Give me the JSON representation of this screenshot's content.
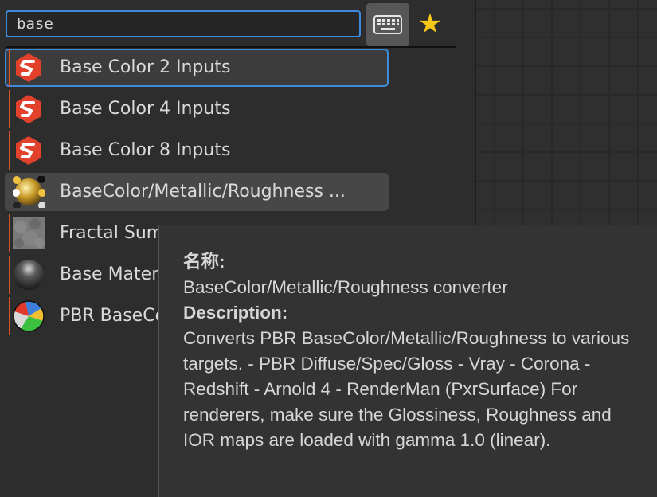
{
  "search": {
    "value": "base"
  },
  "toolbar": {
    "keyboard_icon": "keyboard-icon",
    "favorite_icon": "star-icon",
    "star_color": "#f5c518"
  },
  "colors": {
    "accent": "#3d8bdb",
    "category_bar": "#d4562a",
    "substance_red": "#e2412c"
  },
  "results": [
    {
      "label": "Base Color 2 Inputs",
      "icon": "substance-logo-icon"
    },
    {
      "label": "Base Color 4  Inputs",
      "icon": "substance-logo-icon"
    },
    {
      "label": "Base Color 8 Inputs",
      "icon": "substance-logo-icon"
    },
    {
      "label": "BaseColor/Metallic/Roughness ...",
      "icon": "material-balls-icon"
    },
    {
      "label": "Fractal Sum Base",
      "icon": "fractal-noise-thumbnail-icon"
    },
    {
      "label": "Base Material",
      "icon": "material-sphere-icon"
    },
    {
      "label": "PBR BaseColor",
      "icon": "pbr-sphere-icon"
    }
  ],
  "tooltip": {
    "name_label": "名称:",
    "name_value": "BaseColor/Metallic/Roughness converter",
    "description_label": "Description:",
    "description_text": "Converts PBR BaseColor/Metallic/Roughness to various targets. - PBR Diffuse/Spec/Gloss - Vray - Corona - Redshift - Arnold 4 - RenderMan (PxrSurface) For renderers, make sure the Glossiness, Roughness and IOR maps are loaded with gamma 1.0 (linear)."
  }
}
